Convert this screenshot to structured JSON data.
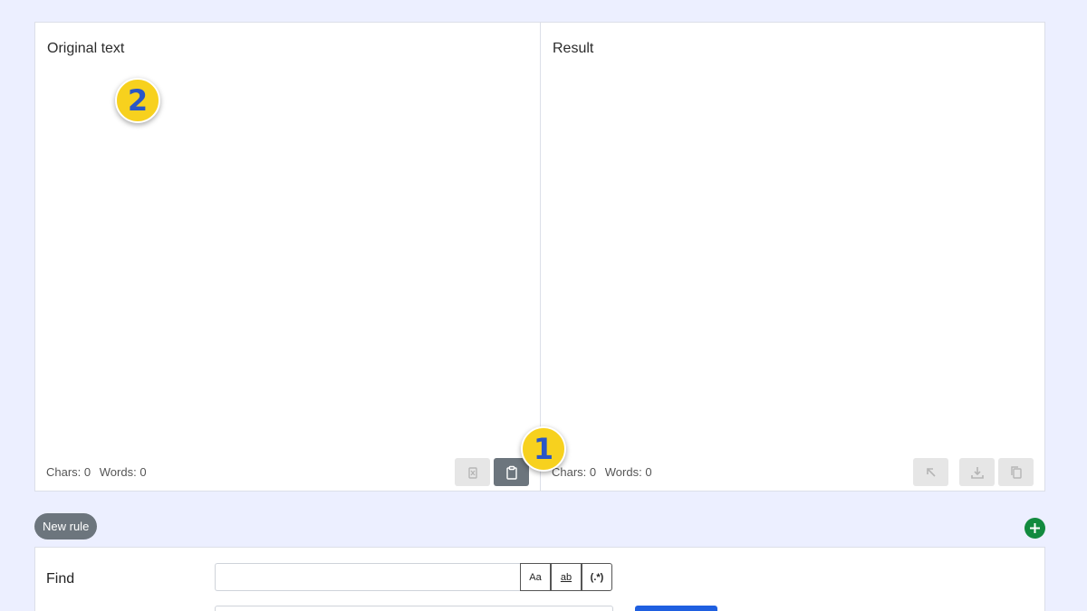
{
  "editor": {
    "original": {
      "title": "Original text",
      "value": "",
      "chars_label": "Chars: 0",
      "words_label": "Words: 0",
      "buttons": [
        "clear-icon",
        "paste-icon"
      ]
    },
    "result": {
      "title": "Result",
      "value": "",
      "chars_label": "Chars: 0",
      "words_label": "Words: 0",
      "buttons": [
        "move-to-original-icon",
        "download-icon",
        "copy-icon"
      ]
    }
  },
  "markers": [
    {
      "label": "1"
    },
    {
      "label": "2"
    }
  ],
  "rules": {
    "new_rule_label": "New rule",
    "find_label": "Find",
    "find_value": "",
    "options": {
      "match_case": "Aa",
      "whole_word": "ab",
      "regex": "(.*)"
    }
  },
  "colors": {
    "background": "#ecefff",
    "marker": "#f7d11e",
    "marker_text": "#2a56c6",
    "add_button": "#128a3e",
    "primary": "#1f5fe0",
    "secondary": "#6c757d"
  }
}
